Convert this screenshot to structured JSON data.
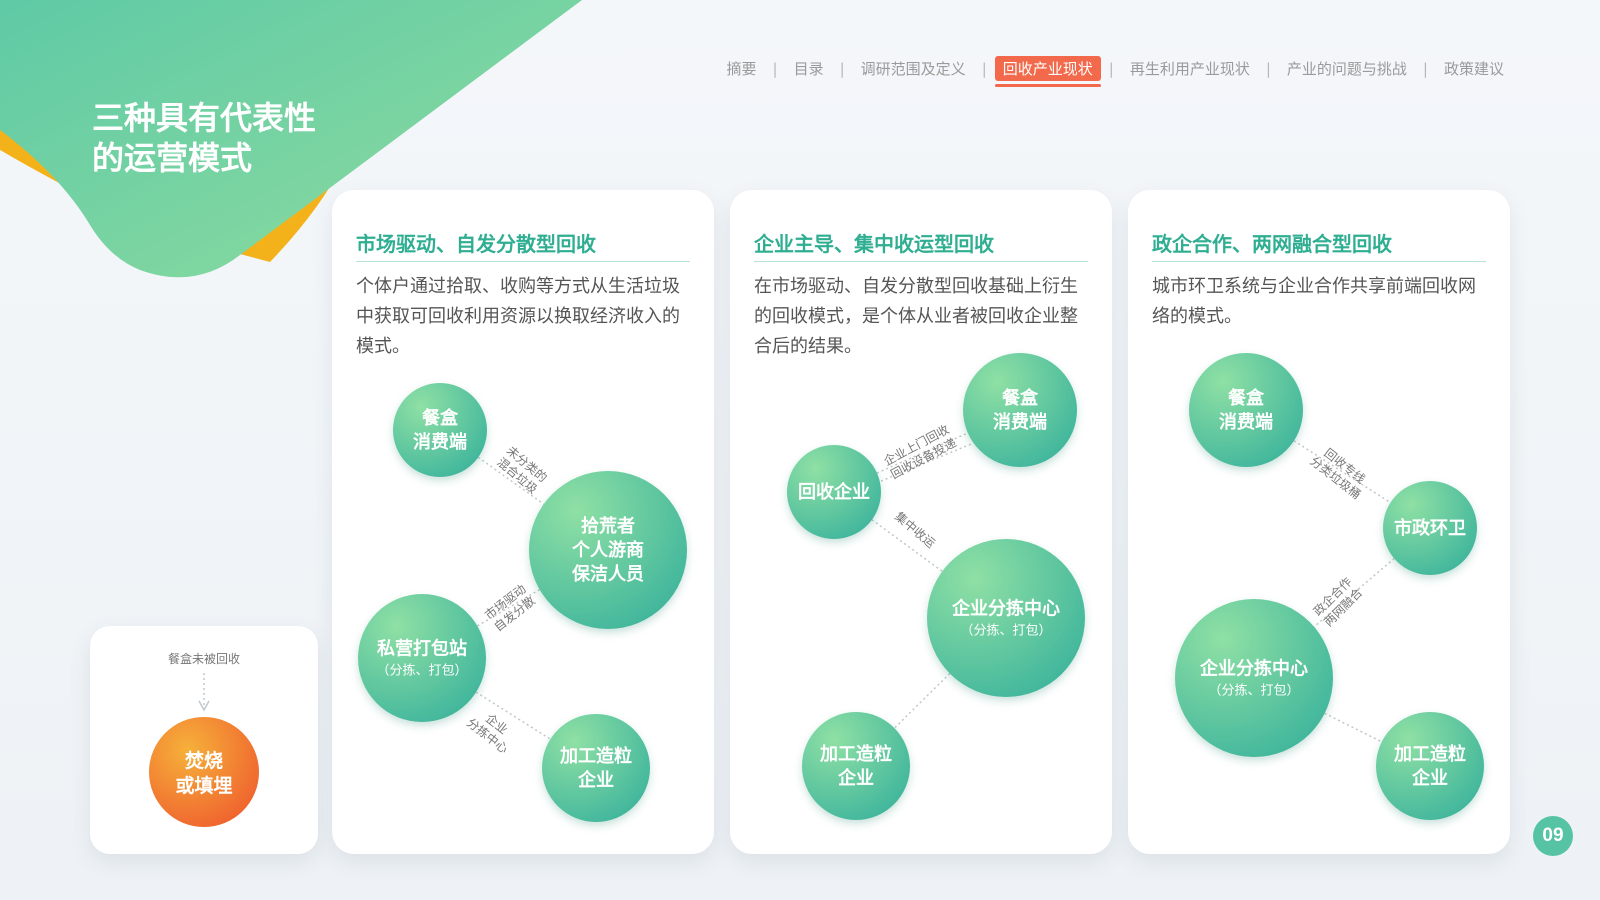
{
  "title": {
    "line1": "三种具有代表性",
    "line2": "的运营模式"
  },
  "nav": {
    "items": [
      "摘要",
      "目录",
      "调研范围及定义",
      "回收产业现状",
      "再生利用产业现状",
      "产业的问题与挑战",
      "政策建议"
    ],
    "separator": "|",
    "active_index": 3
  },
  "colors": {
    "accent": "#f26a4b",
    "green": "#2fae92",
    "yellow": "#f3b21a",
    "orange": "#f07a2b"
  },
  "cards": [
    {
      "heading": "市场驱动、自发分散型回收",
      "description": "个体户通过拾取、收购等方式从生活垃圾中获取可回收利用资源以换取经济收入的模式。",
      "nodes": [
        {
          "lines": [
            "餐盒",
            "消费端"
          ]
        },
        {
          "lines": [
            "拾荒者",
            "个人游商",
            "保洁人员"
          ]
        },
        {
          "lines": [
            "私营打包站"
          ],
          "sub": "（分拣、打包）"
        },
        {
          "lines": [
            "加工造粒",
            "企业"
          ]
        }
      ],
      "edges": [
        {
          "from": 0,
          "to": 1,
          "labels": [
            "未分类的",
            "混合垃圾"
          ]
        },
        {
          "from": 1,
          "to": 2,
          "labels": [
            "市场驱动",
            "自发分散"
          ]
        },
        {
          "from": 2,
          "to": 3,
          "labels": [
            "企业",
            "分拣中心"
          ]
        }
      ]
    },
    {
      "heading": "企业主导、集中收运型回收",
      "description": "在市场驱动、自发分散型回收基础上衍生的回收模式，是个体从业者被回收企业整合后的结果。",
      "nodes": [
        {
          "lines": [
            "餐盒",
            "消费端"
          ]
        },
        {
          "lines": [
            "回收企业"
          ]
        },
        {
          "lines": [
            "企业分拣中心"
          ],
          "sub": "（分拣、打包）"
        },
        {
          "lines": [
            "加工造粒",
            "企业"
          ]
        }
      ],
      "edges": [
        {
          "from": 1,
          "to": 0,
          "labels": [
            "企业上门回收",
            "回收设备投递"
          ]
        },
        {
          "from": 1,
          "to": 2,
          "labels": [
            "集中收运"
          ]
        },
        {
          "from": 2,
          "to": 3,
          "labels": []
        }
      ]
    },
    {
      "heading": "政企合作、两网融合型回收",
      "description": "城市环卫系统与企业合作共享前端回收网络的模式。",
      "nodes": [
        {
          "lines": [
            "餐盒",
            "消费端"
          ]
        },
        {
          "lines": [
            "市政环卫"
          ]
        },
        {
          "lines": [
            "企业分拣中心"
          ],
          "sub": "（分拣、打包）"
        },
        {
          "lines": [
            "加工造粒",
            "企业"
          ]
        }
      ],
      "edges": [
        {
          "from": 0,
          "to": 1,
          "labels": [
            "回收专线",
            "分类垃圾桶"
          ]
        },
        {
          "from": 1,
          "to": 2,
          "labels": [
            "政企合作",
            "两网融合"
          ]
        },
        {
          "from": 2,
          "to": 3,
          "labels": []
        }
      ]
    }
  ],
  "side_card": {
    "note": "餐盒未被回收",
    "node_lines": [
      "焚烧",
      "或填埋"
    ]
  },
  "page_number": "09"
}
